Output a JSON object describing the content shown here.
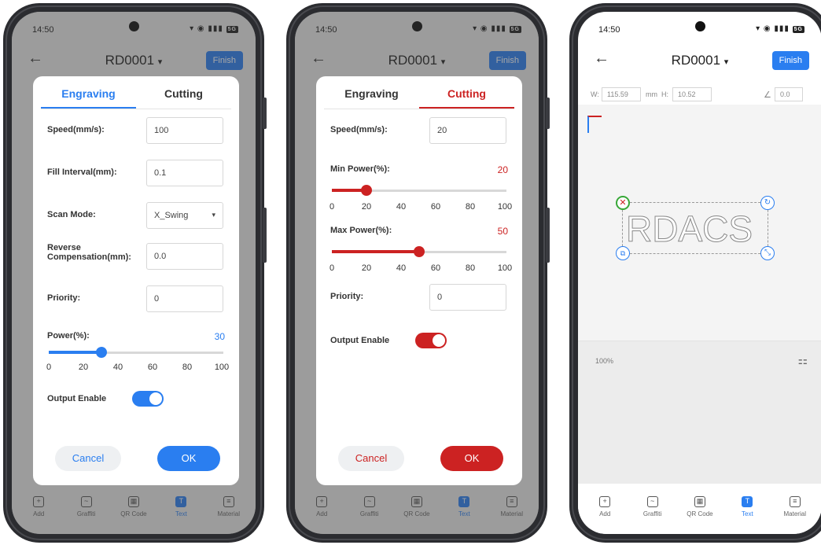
{
  "phones": [
    {
      "time": "14:50",
      "title": "RD0001",
      "finish_label": "Finish",
      "tabs": [
        "Engraving",
        "Cutting"
      ],
      "active_tab": "Engraving",
      "accent": "#2a7ef0",
      "fields": [
        {
          "label": "Speed(mm/s):",
          "value": "100"
        },
        {
          "label": "Fill Interval(mm):",
          "value": "0.1"
        },
        {
          "label": "Scan Mode:",
          "value": "X_Swing"
        },
        {
          "label": "Reverse Compensation(mm):",
          "value": "0.0"
        },
        {
          "label": "Priority:",
          "value": "0"
        }
      ],
      "power_label": "Power(%):",
      "power_value": "30",
      "power_level": 30,
      "tick_labels": [
        "0",
        "20",
        "40",
        "60",
        "80",
        "100"
      ],
      "output_label": "Output Enable",
      "output_enabled": true,
      "cancel_label": "Cancel",
      "ok_label": "OK",
      "bottom_tabs": [
        "Add",
        "Graffiti",
        "QR Code",
        "Text",
        "Material"
      ]
    },
    {
      "time": "14:50",
      "title": "RD0001",
      "finish_label": "Finish",
      "tabs": [
        "Engraving",
        "Cutting"
      ],
      "active_tab": "Cutting",
      "accent": "#cc2222",
      "speed_label": "Speed(mm/s):",
      "speed_value": "20",
      "min_power_label": "Min Power(%):",
      "min_power_value": "20",
      "min_power_level": 20,
      "max_power_label": "Max Power(%):",
      "max_power_value": "50",
      "max_power_level": 50,
      "tick_labels": [
        "0",
        "20",
        "40",
        "60",
        "80",
        "100"
      ],
      "priority_label": "Priority:",
      "priority_value": "0",
      "output_label": "Output Enable",
      "output_enabled": true,
      "cancel_label": "Cancel",
      "ok_label": "OK",
      "bottom_tabs": [
        "Add",
        "Graffiti",
        "QR Code",
        "Text",
        "Material"
      ]
    },
    {
      "time": "14:50",
      "title": "RD0001",
      "finish_label": "Finish",
      "width_label": "W:",
      "width_value": "115.59",
      "unit": "mm",
      "height_label": "H:",
      "height_value": "10.52",
      "angle_value": "0.0",
      "canvas_text": "RDACS",
      "zoom_label": "100%",
      "bottom_tabs": [
        "Add",
        "Graffiti",
        "QR Code",
        "Text",
        "Material"
      ],
      "active_bottom_tab": "Text"
    }
  ]
}
